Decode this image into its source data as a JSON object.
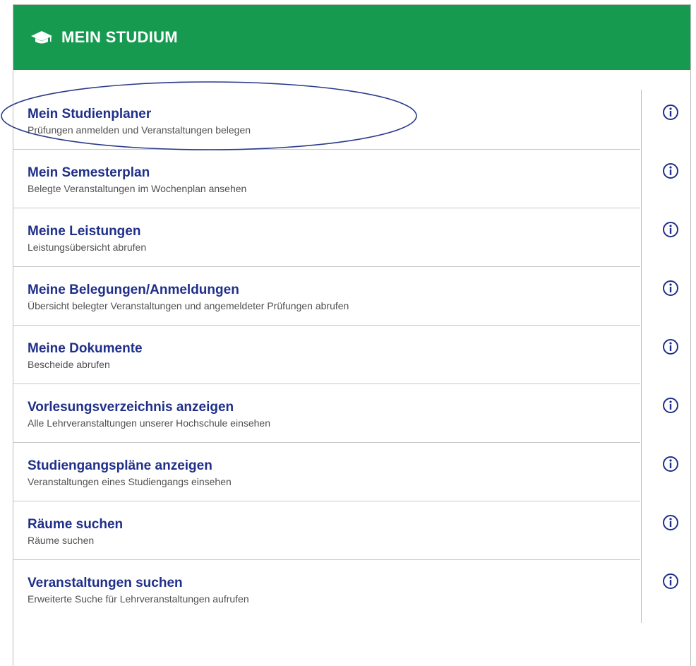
{
  "header": {
    "title": "MEIN STUDIUM",
    "icon": "graduation-cap-icon",
    "bg_color": "#159a4f"
  },
  "items": [
    {
      "title": "Mein Studienplaner",
      "subtitle": "Prüfungen anmelden und Veranstaltungen belegen"
    },
    {
      "title": "Mein Semesterplan",
      "subtitle": "Belegte Veranstaltungen im Wochenplan ansehen"
    },
    {
      "title": "Meine Leistungen",
      "subtitle": "Leistungsübersicht abrufen"
    },
    {
      "title": "Meine Belegungen/Anmeldungen",
      "subtitle": "Übersicht belegter Veranstaltungen und angemeldeter Prüfungen abrufen"
    },
    {
      "title": "Meine Dokumente",
      "subtitle": "Bescheide abrufen"
    },
    {
      "title": "Vorlesungsverzeichnis anzeigen",
      "subtitle": "Alle Lehrveranstaltungen unserer Hochschule einsehen"
    },
    {
      "title": "Studiengangspläne anzeigen",
      "subtitle": "Veranstaltungen eines Studiengangs einsehen"
    },
    {
      "title": "Räume suchen",
      "subtitle": "Räume suchen"
    },
    {
      "title": "Veranstaltungen suchen",
      "subtitle": "Erweiterte Suche für Lehrveranstaltungen aufrufen"
    }
  ],
  "colors": {
    "item_title": "#1f2f8a",
    "annotation_ellipse": "#2a3a8a"
  },
  "annotation": {
    "shape": "ellipse",
    "highlights": "Mein Studienplaner"
  }
}
